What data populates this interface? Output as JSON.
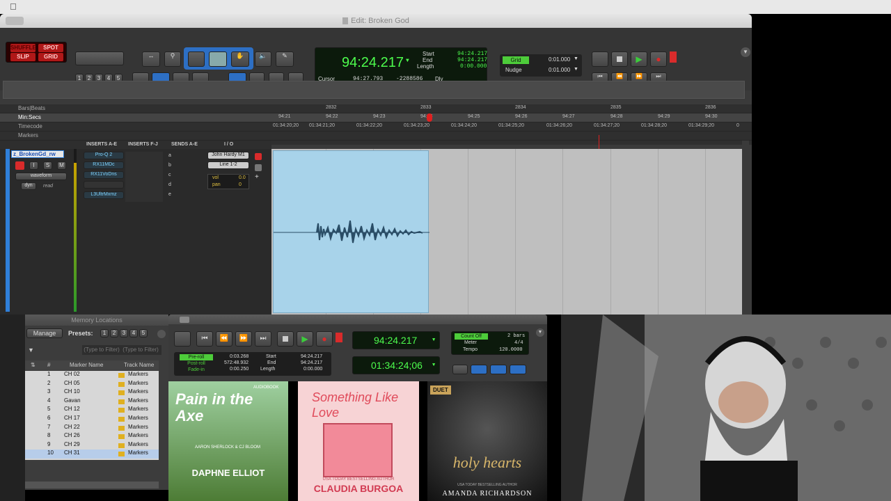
{
  "menubar": {
    "apple_icon": "apple-icon"
  },
  "edit_window": {
    "title": "Edit: Broken God",
    "modes": {
      "shuffle": "SHUFFLE",
      "spot": "SPOT",
      "slip": "SLIP",
      "grid": "GRID"
    },
    "zoom_presets": [
      "1",
      "2",
      "3",
      "4",
      "5"
    ],
    "counter": {
      "main": "94:24.217",
      "start_label": "Start",
      "start": "94:24.217",
      "end_label": "End",
      "end": "94:24.217",
      "length_label": "Length",
      "length": "0:00.000",
      "cursor_label": "Cursor",
      "cursor": "94:27.793",
      "cursor_extra": "-2288586",
      "dly_label": "Dly"
    },
    "grid": {
      "grid_label": "Grid",
      "grid_value": "0:01.000",
      "nudge_label": "Nudge",
      "nudge_value": "0:01.000"
    }
  },
  "rulers": {
    "names": [
      "Bars|Beats",
      "Min:Secs",
      "Timecode",
      "Markers"
    ],
    "bars": [
      "2832",
      "2833",
      "2834",
      "2835",
      "2836"
    ],
    "minsecs": [
      "94:21",
      "94:22",
      "94:23",
      "94:24",
      "94:25",
      "94:26",
      "94:27",
      "94:28",
      "94:29",
      "94:30"
    ],
    "timecode": [
      "01:34:20;20",
      "01:34:21;20",
      "01:34:22;20",
      "01:34:23;20",
      "01:34:24;20",
      "01:34:25;20",
      "01:34:26;20",
      "01:34:27;20",
      "01:34:28;20",
      "01:34:29;20",
      "0"
    ]
  },
  "mix": {
    "headers": {
      "inserts_ae": "INSERTS A-E",
      "inserts_fj": "INSERTS F-J",
      "sends_ae": "SENDS A-E",
      "io": "I / O"
    },
    "track_name": "z_BrokenGd_rw",
    "buttons": {
      "rec": "",
      "input": "I",
      "solo": "S",
      "mute": "M"
    },
    "view": "waveform",
    "dyn": "dyn",
    "auto": "read",
    "inserts": [
      "Pro-Q 2",
      "RX11MDc",
      "RX11VoDns",
      "",
      "L3UltrMxmz"
    ],
    "sends": [
      "a",
      "b",
      "c",
      "d",
      "e"
    ],
    "io": {
      "input": "John Hardy M1",
      "output": "Line 1-2",
      "vol_label": "vol",
      "vol": "0.0",
      "pan_label": "pan",
      "pan": "0"
    }
  },
  "memory": {
    "title": "Memory Locations",
    "manage": "Manage",
    "presets_label": "Presets:",
    "presets": [
      "1",
      "2",
      "3",
      "4",
      "5"
    ],
    "filter_placeholder": "(Type to Filter)",
    "columns": {
      "num": "#",
      "marker": "Marker Name",
      "track": "Track Name"
    },
    "rows": [
      {
        "num": "1",
        "name": "CH 02",
        "track": "Markers"
      },
      {
        "num": "2",
        "name": "CH 05",
        "track": "Markers"
      },
      {
        "num": "3",
        "name": "CH 10",
        "track": "Markers"
      },
      {
        "num": "4",
        "name": "Gavan",
        "track": "Markers"
      },
      {
        "num": "5",
        "name": "CH 12",
        "track": "Markers"
      },
      {
        "num": "6",
        "name": "CH 17",
        "track": "Markers"
      },
      {
        "num": "7",
        "name": "CH 22",
        "track": "Markers"
      },
      {
        "num": "8",
        "name": "CH 26",
        "track": "Markers"
      },
      {
        "num": "9",
        "name": "CH 29",
        "track": "Markers"
      },
      {
        "num": "10",
        "name": "CH 31",
        "track": "Markers"
      }
    ]
  },
  "transport": {
    "preroll_label": "Pre-roll",
    "preroll": "0:03.268",
    "postroll_label": "Post-roll",
    "postroll": "572:48.932",
    "fadein_label": "Fade-in",
    "fadein": "0:00.250",
    "start_label": "Start",
    "start": "94:24.217",
    "end_label": "End",
    "end": "94:24.217",
    "length_label": "Length",
    "length": "0:00.000",
    "main_counter": "94:24.217",
    "sub_counter": "01:34:24;06",
    "count_off_label": "Count Off",
    "count_off": "2 bars",
    "meter_label": "Meter",
    "meter": "4/4",
    "tempo_label": "Tempo",
    "tempo": "120.0000"
  },
  "books": [
    {
      "title": "Pain in the Axe",
      "top": "AUDIOBOOK",
      "author_small": "AARON SHERLOCK & CJ BLOOM",
      "author": "DAPHNE ELLIOT",
      "bg": "#5f8a3e"
    },
    {
      "title": "Something Like Love",
      "top": "USA TODAY BESTSELLING AUTHOR",
      "author": "CLAUDIA BURGOA",
      "bg": "#f2c2c6"
    },
    {
      "title": "holy hearts",
      "top": "DUET",
      "author_small": "USA TODAY BESTSELLING AUTHOR",
      "author": "AMANDA RICHARDSON",
      "bg": "#1c1c1c"
    }
  ],
  "colors": {
    "clip": "#a8d3ea",
    "lcd_text": "#4dfc4d",
    "rec": "#d92b2b",
    "play": "#3ccc3c",
    "track_blue": "#2f7fd9"
  }
}
